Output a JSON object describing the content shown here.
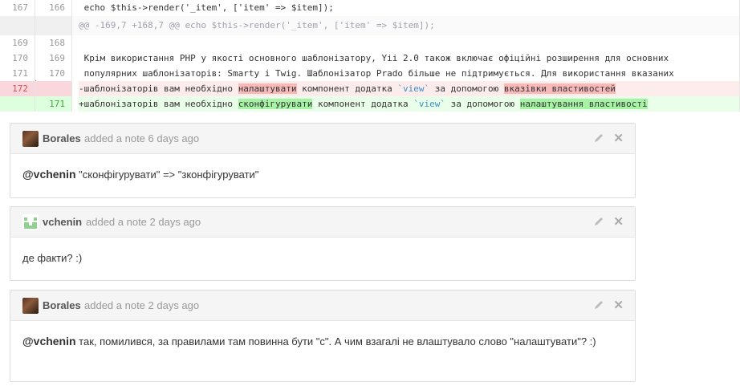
{
  "diff": {
    "context_top": {
      "old": "167",
      "new": "166",
      "text": " echo $this->render('_item', ['item' => $item]);"
    },
    "hunk": {
      "text": "@@ -169,7 +168,7 @@ echo $this->render('_item', ['item' => $item]);"
    },
    "lines": [
      {
        "old": "169",
        "new": "168",
        "text": ""
      },
      {
        "old": "170",
        "new": "169",
        "text": " Крім використання PHP у якості основного шаблонізатору, Yii 2.0 також включає офіційні розширення для основних"
      },
      {
        "old": "171",
        "new": "170",
        "text": " популярних шаблонізаторів: Smarty і Twig. Шаблонізатор Prado більше не підтримується. Для використання вказаних"
      }
    ],
    "deleted": {
      "old": "172",
      "p1": "-шаблонізаторів вам необхідно ",
      "hl1": "налаштувати",
      "p2": " компонент додатка ",
      "code": "`view`",
      "p3": " за допомогою ",
      "hl2": "вказівки властивостей"
    },
    "added": {
      "new": "171",
      "p1": "+шаблонізаторів вам необхідно ",
      "hl1": "сконфігурувати",
      "p2": " компонент додатка ",
      "code": "`view`",
      "p3": " за допомогою ",
      "hl2": "налаштування властивості"
    }
  },
  "notes": [
    {
      "author": "Borales",
      "meta": "added a note 6 days ago",
      "mention": "@vchenin",
      "body": " \"сконфігурувати\" => \"зконфігурувати\""
    },
    {
      "author": "vchenin",
      "meta": "added a note 2 days ago",
      "mention": "",
      "body": "де факти? :)"
    },
    {
      "author": "Borales",
      "meta": "added a note 2 days ago",
      "mention": "@vchenin",
      "body": " так, помилився, за правилами там повинна бути \"с\". А чим взагалі не влаштувало слово \"налаштувати\"? :)"
    }
  ],
  "colors": {
    "deleted_highlight": "#f8b9b9",
    "added_highlight": "#a6f3a6",
    "identicon": "#8fd18f"
  }
}
